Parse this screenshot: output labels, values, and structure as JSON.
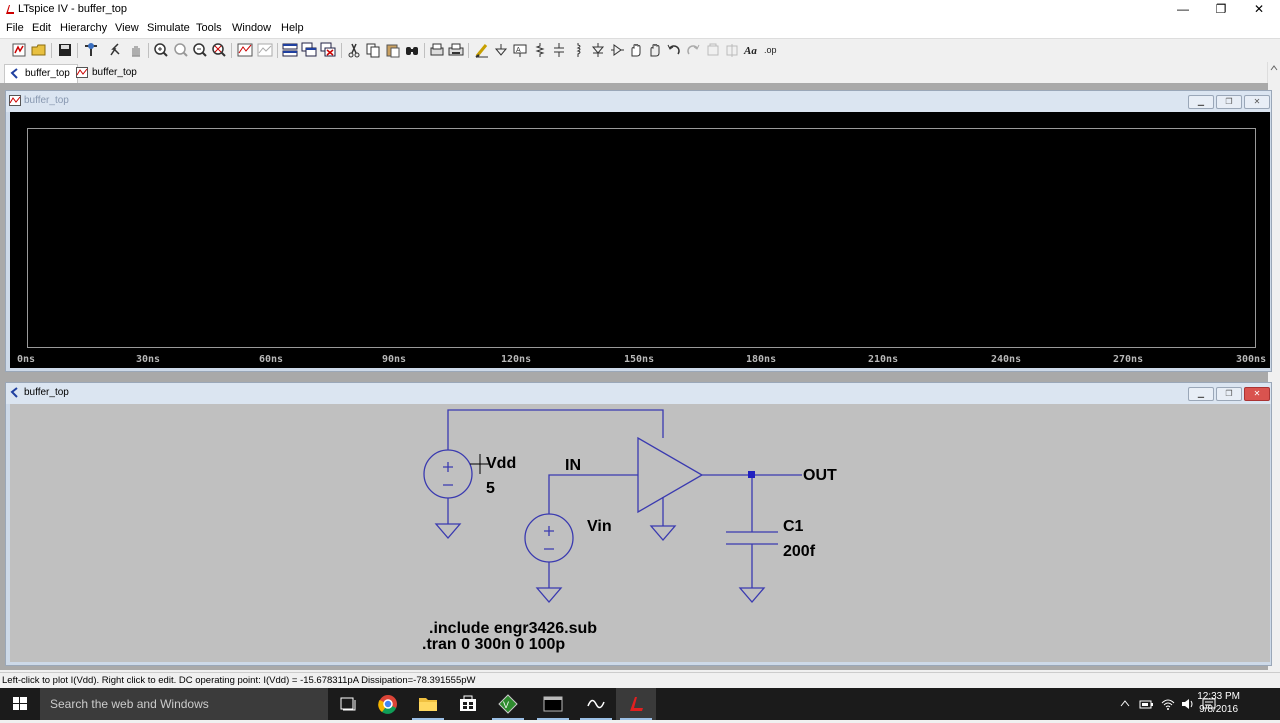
{
  "window": {
    "title": "LTspice IV - buffer_top",
    "minimize": "—",
    "restore": "❐",
    "close": "✕"
  },
  "menu": [
    "File",
    "Edit",
    "Hierarchy",
    "View",
    "Simulate",
    "Tools",
    "Window",
    "Help"
  ],
  "tabs": [
    {
      "label": "buffer_top",
      "icon": "schematic-icon"
    },
    {
      "label": "buffer_top",
      "icon": "waveform-icon"
    }
  ],
  "waveform_window": {
    "title": "buffer_top",
    "x_ticks": [
      "0ns",
      "30ns",
      "60ns",
      "90ns",
      "120ns",
      "150ns",
      "180ns",
      "210ns",
      "240ns",
      "270ns",
      "300ns"
    ]
  },
  "schematic_window": {
    "title": "buffer_top",
    "components": {
      "vdd": {
        "name": "Vdd",
        "value": "5"
      },
      "vin": {
        "name": "Vin"
      },
      "c1": {
        "name": "C1",
        "value": "200f"
      },
      "net_in": "IN",
      "net_out": "OUT"
    },
    "directives": [
      ".include engr3426.sub",
      ".tran 0 300n 0 100p"
    ]
  },
  "status": "Left-click to plot I(Vdd).  Right click to edit.  DC operating point: I(Vdd) = -15.678311pA   Dissipation=-78.391555pW",
  "taskbar": {
    "search_placeholder": "Search the web and Windows",
    "time": "12:33 PM",
    "date": "9/8/2016"
  },
  "colors": {
    "wire": "#3a3ab0",
    "plot_bg": "#000000",
    "schematic_bg": "#c0c0c0"
  }
}
